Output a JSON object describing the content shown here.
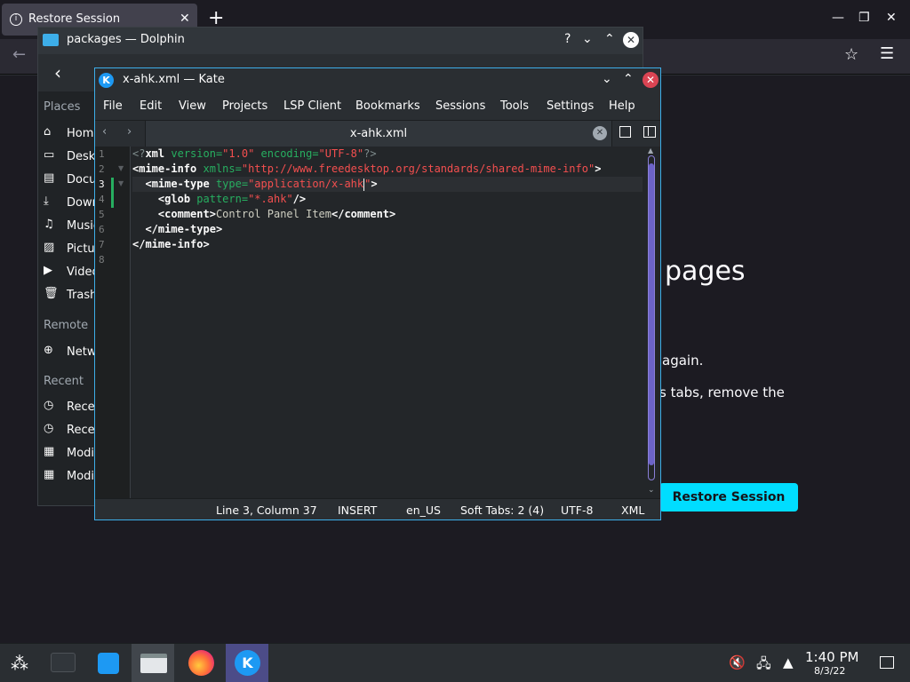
{
  "firefox": {
    "tab_title": "Restore Session",
    "tab_close": "✕",
    "new_tab": "+",
    "heading": "pages",
    "text_line1": "again.",
    "text_line2": "s tabs, remove the",
    "restore_button": "Restore Session"
  },
  "dolphin": {
    "title": "packages — Dolphin",
    "help_glyph": "?",
    "sidebar": {
      "places_label": "Places",
      "places": [
        "Home",
        "Desk",
        "Docu",
        "Down",
        "Music",
        "Pictu",
        "Video",
        "Trash"
      ],
      "remote_label": "Remote",
      "remote": [
        "Netw"
      ],
      "recent_label": "Recent",
      "recent": [
        "Recer",
        "Recer",
        "Modi",
        "Modi"
      ]
    }
  },
  "kate": {
    "title": "x-ahk.xml — Kate",
    "menu": [
      "File",
      "Edit",
      "View",
      "Projects",
      "LSP Client",
      "Bookmarks",
      "Sessions",
      "Tools",
      "Settings",
      "Help"
    ],
    "tab_name": "x-ahk.xml",
    "line_numbers": [
      "1",
      "2",
      "3",
      "4",
      "5",
      "6",
      "7",
      "8"
    ],
    "code": {
      "l1": {
        "open": "<?",
        "tag": "xml",
        "a1": " version=",
        "v1": "\"1.0\"",
        "a2": " encoding=",
        "v2": "\"UTF-8\"",
        "close": "?>"
      },
      "l2": {
        "lt": "<",
        "tag": "mime-info",
        "a1": " xmlns=",
        "v1": "\"http://www.freedesktop.org/standards/shared-mime-info\"",
        "gt": ">"
      },
      "l3": {
        "indent": "  ",
        "lt": "<",
        "tag": "mime-type",
        "a1": " type=",
        "v1a": "\"application/x-ahk",
        "v1b": "\"",
        "gt": ">"
      },
      "l4": {
        "indent": "    ",
        "lt": "<",
        "tag": "glob",
        "a1": " pattern=",
        "v1": "\"*.ahk\"",
        "gt": "/>"
      },
      "l5": {
        "indent": "    ",
        "lt": "<",
        "tag": "comment",
        "gt": ">",
        "text": "Control Panel Item",
        "lt2": "</",
        "tag2": "comment",
        "gt2": ">"
      },
      "l6": {
        "indent": "  ",
        "lt": "</",
        "tag": "mime-type",
        "gt": ">"
      },
      "l7": {
        "lt": "</",
        "tag": "mime-info",
        "gt": ">"
      }
    },
    "status": {
      "position": "Line 3, Column 37",
      "mode": "INSERT",
      "dictionary": "en_US",
      "indent": "Soft Tabs: 2 (4)",
      "encoding": "UTF-8",
      "syntax": "XML"
    }
  },
  "taskbar": {
    "time": "1:40 PM",
    "date": "8/3/22"
  },
  "colors": {
    "accent": "#3daee9",
    "restore_button": "#00ddff",
    "kate_close": "#da4453",
    "xml_attr": "#27ae60",
    "xml_value": "#f44f4f"
  },
  "icons": [
    "info-icon",
    "plus-icon",
    "minimize-icon",
    "maximize-icon",
    "close-icon",
    "back-arrow-icon",
    "star-icon",
    "hamburger-menu-icon",
    "folder-icon",
    "help-icon",
    "kate-icon",
    "chevron-left-icon",
    "chevron-right-icon",
    "split-view-icon",
    "mute-icon",
    "network-icon",
    "tray-arrow-icon"
  ]
}
